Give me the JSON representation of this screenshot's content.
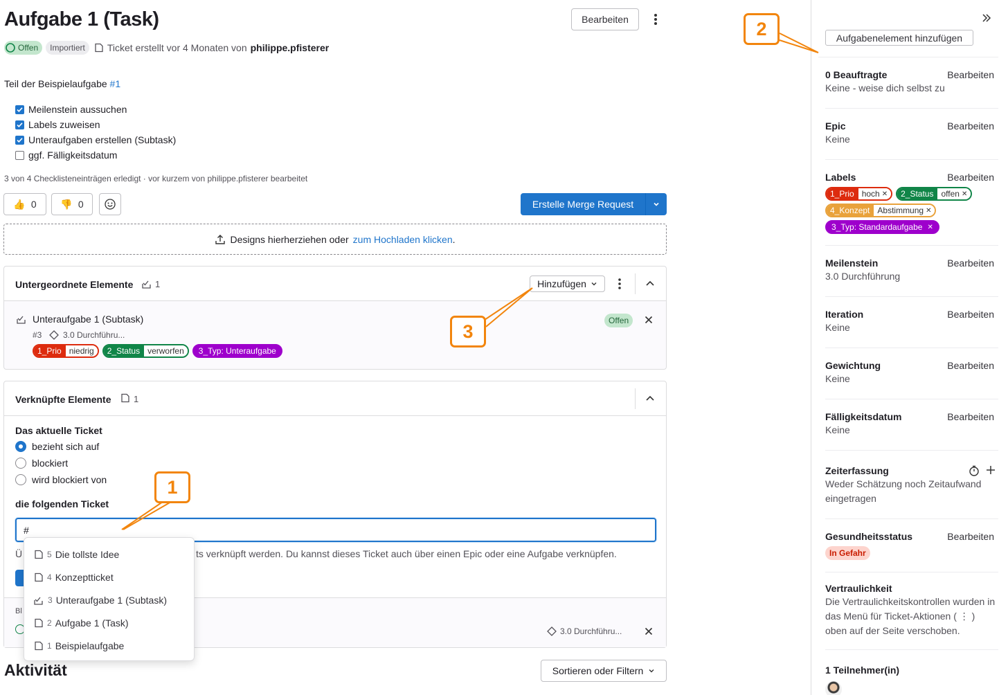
{
  "title": "Aufgabe 1 (Task)",
  "header": {
    "edit_button": "Bearbeiten",
    "status_open": "Offen",
    "status_imported": "Importiert",
    "created_prefix": "Ticket erstellt vor 4 Monaten von",
    "author": "philippe.pfisterer"
  },
  "parent": {
    "prefix": "Teil der Beispielaufgabe",
    "link": "#1"
  },
  "checklist": [
    {
      "label": "Meilenstein aussuchen",
      "checked": true
    },
    {
      "label": "Labels zuweisen",
      "checked": true
    },
    {
      "label": "Unteraufgaben erstellen (Subtask)",
      "checked": true
    },
    {
      "label": "ggf. Fälligkeitsdatum",
      "checked": false
    }
  ],
  "checklist_summary": "3 von 4 Checklisteneinträgen erledigt · vor kurzem von philippe.pfisterer bearbeitet",
  "reactions": {
    "thumbs_up": "0",
    "thumbs_down": "0"
  },
  "merge_request_button": "Erstelle Merge Request",
  "upload": {
    "text": "Designs hierherziehen oder",
    "link": "zum Hochladen klicken",
    "suffix": "."
  },
  "child_items": {
    "title": "Untergeordnete Elemente",
    "count": "1",
    "add_button": "Hinzufügen",
    "item": {
      "title": "Unteraufgabe 1 (Subtask)",
      "ref": "#3",
      "milestone": "3.0 Durchführu...",
      "status": "Offen",
      "labels": [
        {
          "key": "1_Prio",
          "value": "niedrig",
          "color": "#dd2b0e"
        },
        {
          "key": "2_Status",
          "value": "verworfen",
          "color": "#108548"
        }
      ],
      "type_label": "3_Typ: Unteraufgabe",
      "type_color": "#9e00cc"
    }
  },
  "linked_items": {
    "title": "Verknüpfte Elemente",
    "count": "1",
    "current_ticket": "Das aktuelle Ticket",
    "options": [
      "bezieht sich auf",
      "blockiert",
      "wird blockiert von"
    ],
    "following": "die folgenden Ticket",
    "input_value": "#",
    "help_prefix": "Ü",
    "help_text": "ts verknüpft werden. Du kannst dieses Ticket auch über einen Epic oder eine Aufgabe verknüpfen.",
    "blocked_prefix": "Bl",
    "milestone": "3.0 Durchführu..."
  },
  "dropdown": [
    {
      "num": "5",
      "label": "Die tollste Idee",
      "type": "issue"
    },
    {
      "num": "4",
      "label": "Konzeptticket",
      "type": "issue"
    },
    {
      "num": "3",
      "label": "Unteraufgabe 1 (Subtask)",
      "type": "task"
    },
    {
      "num": "2",
      "label": "Aufgabe 1 (Task)",
      "type": "issue"
    },
    {
      "num": "1",
      "label": "Beispielaufgabe",
      "type": "issue"
    }
  ],
  "activity": {
    "title": "Aktivität",
    "sort_button": "Sortieren oder Filtern"
  },
  "sidebar": {
    "add_task_button": "Aufgabenelement hinzufügen",
    "edit": "Bearbeiten",
    "assignees": {
      "title": "0 Beauftragte",
      "value": "Keine - weise dich selbst zu"
    },
    "epic": {
      "title": "Epic",
      "value": "Keine"
    },
    "labels": {
      "title": "Labels",
      "items": [
        {
          "key": "1_Prio",
          "value": "hoch",
          "color": "#dd2b0e"
        },
        {
          "key": "2_Status",
          "value": "offen",
          "color": "#108548"
        },
        {
          "key": "4_Konzept",
          "value": "Abstimmung",
          "color": "#e9a23b"
        }
      ],
      "type_label": "3_Typ: Standardaufgabe",
      "type_color": "#9e00cc"
    },
    "milestone": {
      "title": "Meilenstein",
      "value": "3.0 Durchführung"
    },
    "iteration": {
      "title": "Iteration",
      "value": "Keine"
    },
    "weight": {
      "title": "Gewichtung",
      "value": "Keine"
    },
    "due_date": {
      "title": "Fälligkeitsdatum",
      "value": "Keine"
    },
    "time_tracking": {
      "title": "Zeiterfassung",
      "value": "Weder Schätzung noch Zeitaufwand eingetragen"
    },
    "health": {
      "title": "Gesundheitsstatus",
      "value": "In Gefahr"
    },
    "confidentiality": {
      "title": "Vertraulichkeit",
      "value": "Die Vertraulichkeitskontrollen wurden in das Menü für Ticket-Aktionen ( ⋮ ) oben auf der Seite verschoben."
    },
    "participants": {
      "title": "1 Teilnehmer(in)"
    }
  },
  "callouts": [
    "1",
    "2",
    "3"
  ],
  "colors": {
    "accent": "#1f75cb",
    "callout": "#f2850d",
    "open": "#108548"
  }
}
